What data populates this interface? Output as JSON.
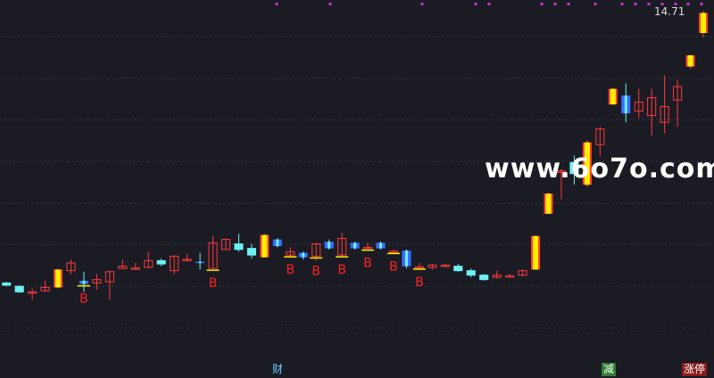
{
  "chart_data": {
    "type": "candlestick",
    "last_price": "14.71",
    "y_range": [
      1.0,
      16.5
    ],
    "colors": {
      "background": "#1b1b24",
      "grid": "#3a3a4a",
      "up": "#ff3b3b",
      "down": "#6cf0f0",
      "limit_up_fill": "#ffee00",
      "buy_signal_fill": "#3a6cff",
      "signal_text": "#ff2222",
      "marker_dot": "#cc33cc"
    },
    "candles": [
      {
        "o": 4.3,
        "c": 4.2,
        "h": 4.35,
        "l": 4.15,
        "s": "down"
      },
      {
        "o": 4.15,
        "c": 3.9,
        "h": 4.2,
        "l": 3.85,
        "s": "down"
      },
      {
        "o": 3.85,
        "c": 3.9,
        "h": 4.05,
        "l": 3.55,
        "s": "up"
      },
      {
        "o": 3.95,
        "c": 4.1,
        "h": 4.4,
        "l": 3.9,
        "s": "up"
      },
      {
        "o": 4.1,
        "c": 4.9,
        "h": 4.95,
        "l": 4.05,
        "s": "limit"
      },
      {
        "o": 4.85,
        "c": 5.2,
        "h": 5.35,
        "l": 4.7,
        "s": "up"
      },
      {
        "o": 4.4,
        "c": 4.25,
        "h": 4.8,
        "l": 3.9,
        "s": "blue",
        "b": true
      },
      {
        "o": 4.3,
        "c": 4.45,
        "h": 4.7,
        "l": 4.0,
        "s": "up"
      },
      {
        "o": 4.35,
        "c": 4.8,
        "h": 4.85,
        "l": 3.55,
        "s": "up"
      },
      {
        "o": 4.95,
        "c": 5.05,
        "h": 5.35,
        "l": 4.95,
        "s": "up"
      },
      {
        "o": 4.95,
        "c": 4.97,
        "h": 5.2,
        "l": 4.9,
        "s": "up"
      },
      {
        "o": 5.0,
        "c": 5.3,
        "h": 5.7,
        "l": 4.95,
        "s": "up"
      },
      {
        "o": 5.3,
        "c": 5.15,
        "h": 5.4,
        "l": 5.05,
        "s": "down"
      },
      {
        "o": 4.85,
        "c": 5.5,
        "h": 5.55,
        "l": 4.7,
        "s": "up"
      },
      {
        "o": 5.35,
        "c": 5.36,
        "h": 5.6,
        "l": 5.3,
        "s": "up"
      },
      {
        "o": 5.25,
        "c": 5.22,
        "h": 5.65,
        "l": 4.9,
        "s": "blue"
      },
      {
        "o": 4.95,
        "c": 6.1,
        "h": 6.4,
        "l": 4.95,
        "s": "up",
        "b": true
      },
      {
        "o": 5.8,
        "c": 6.25,
        "h": 6.3,
        "l": 5.8,
        "s": "up"
      },
      {
        "o": 6.05,
        "c": 5.8,
        "h": 6.5,
        "l": 5.7,
        "s": "down"
      },
      {
        "o": 5.55,
        "c": 5.85,
        "h": 6.05,
        "l": 5.4,
        "s": "down"
      },
      {
        "o": 5.45,
        "c": 6.45,
        "h": 6.5,
        "l": 5.45,
        "s": "limit"
      },
      {
        "o": 6.25,
        "c": 5.95,
        "h": 6.3,
        "l": 5.9,
        "s": "blue"
      },
      {
        "o": 5.7,
        "c": 5.55,
        "h": 5.9,
        "l": 5.45,
        "s": "up",
        "b": true
      },
      {
        "o": 5.65,
        "c": 5.45,
        "h": 5.7,
        "l": 5.35,
        "s": "blue"
      },
      {
        "o": 5.5,
        "c": 6.05,
        "h": 6.1,
        "l": 5.3,
        "s": "up",
        "b": true
      },
      {
        "o": 5.85,
        "c": 6.15,
        "h": 6.25,
        "l": 5.8,
        "s": "blue"
      },
      {
        "o": 5.55,
        "c": 6.3,
        "h": 6.55,
        "l": 5.5,
        "s": "up",
        "b": true
      },
      {
        "o": 5.85,
        "c": 6.1,
        "h": 6.15,
        "l": 5.8,
        "s": "blue"
      },
      {
        "o": 5.85,
        "c": 5.9,
        "h": 6.1,
        "l": 5.8,
        "s": "up",
        "b": true
      },
      {
        "o": 5.85,
        "c": 6.1,
        "h": 6.15,
        "l": 5.8,
        "s": "blue"
      },
      {
        "o": 5.7,
        "c": 5.72,
        "h": 5.8,
        "l": 5.65,
        "s": "up",
        "b": true
      },
      {
        "o": 5.75,
        "c": 5.05,
        "h": 5.8,
        "l": 4.95,
        "s": "blue"
      },
      {
        "o": 5.0,
        "c": 5.02,
        "h": 5.2,
        "l": 4.95,
        "s": "up",
        "b": true
      },
      {
        "o": 5.0,
        "c": 5.1,
        "h": 5.15,
        "l": 4.9,
        "s": "up"
      },
      {
        "o": 5.1,
        "c": 5.05,
        "h": 5.15,
        "l": 5.0,
        "s": "up"
      },
      {
        "o": 5.05,
        "c": 4.85,
        "h": 5.15,
        "l": 4.8,
        "s": "down"
      },
      {
        "o": 4.85,
        "c": 4.65,
        "h": 4.95,
        "l": 4.55,
        "s": "down"
      },
      {
        "o": 4.65,
        "c": 4.45,
        "h": 4.7,
        "l": 4.4,
        "s": "down"
      },
      {
        "o": 4.55,
        "c": 4.65,
        "h": 4.85,
        "l": 4.5,
        "s": "up"
      },
      {
        "o": 4.6,
        "c": 4.62,
        "h": 4.7,
        "l": 4.55,
        "s": "up"
      },
      {
        "o": 4.65,
        "c": 4.85,
        "h": 4.9,
        "l": 4.6,
        "s": "up"
      },
      {
        "o": 4.9,
        "c": 6.4,
        "h": 6.45,
        "l": 4.9,
        "s": "limit"
      },
      {
        "o": 7.4,
        "c": 8.3,
        "h": 8.35,
        "l": 7.4,
        "s": "limit"
      },
      {
        "o": 9.3,
        "c": 9.32,
        "h": 9.4,
        "l": 8.05,
        "s": "up"
      },
      {
        "o": 9.7,
        "c": 9.2,
        "h": 10.0,
        "l": 8.7,
        "s": "down"
      },
      {
        "o": 8.7,
        "c": 10.6,
        "h": 10.7,
        "l": 8.6,
        "s": "limit"
      },
      {
        "o": 10.5,
        "c": 11.2,
        "h": 11.3,
        "l": 10.0,
        "s": "up"
      },
      {
        "o": 12.3,
        "c": 13.0,
        "h": 13.05,
        "l": 12.3,
        "s": "limit"
      },
      {
        "o": 12.7,
        "c": 11.9,
        "h": 13.25,
        "l": 11.5,
        "s": "blue"
      },
      {
        "o": 12.0,
        "c": 12.4,
        "h": 13.0,
        "l": 11.7,
        "s": "up"
      },
      {
        "o": 11.8,
        "c": 12.6,
        "h": 13.0,
        "l": 10.9,
        "s": "up"
      },
      {
        "o": 11.5,
        "c": 12.2,
        "h": 13.6,
        "l": 11.0,
        "s": "up"
      },
      {
        "o": 12.5,
        "c": 13.1,
        "h": 13.4,
        "l": 11.3,
        "s": "up"
      },
      {
        "o": 14.0,
        "c": 14.5,
        "h": 14.55,
        "l": 13.9,
        "s": "limit"
      },
      {
        "o": 15.5,
        "c": 16.4,
        "h": 16.5,
        "l": 15.3,
        "s": "limit"
      }
    ],
    "signal_label": "B",
    "bottom_tags": {
      "cai": "财",
      "jian": "减",
      "zhangting": "涨停"
    },
    "watermark": "www.6o7o.com"
  }
}
